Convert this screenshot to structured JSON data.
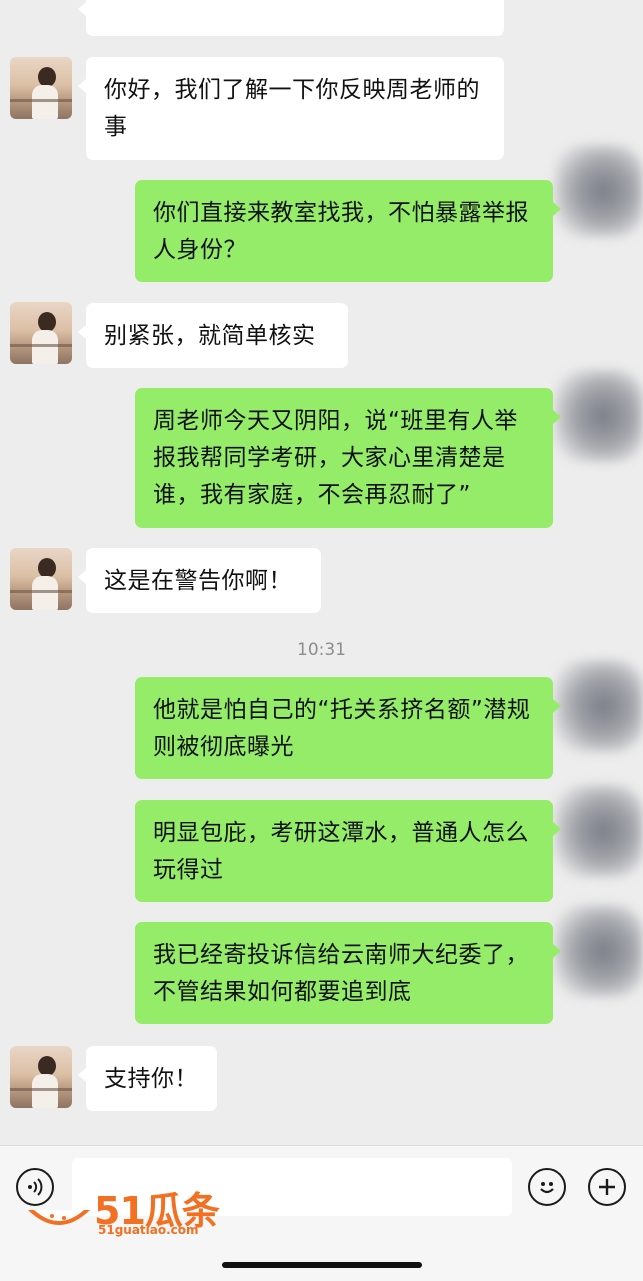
{
  "messages": [
    {
      "side": "left",
      "text": "你好，我们了解一下你反映周老师的事"
    },
    {
      "side": "right",
      "text": "你们直接来教室找我，不怕暴露举报人身份？"
    },
    {
      "side": "left",
      "text": "别紧张，就简单核实"
    },
    {
      "side": "right",
      "text": "周老师今天又阴阳，说“班里有人举报我帮同学考研，大家心里清楚是谁，我有家庭，不会再忍耐了”"
    },
    {
      "side": "left",
      "text": "这是在警告你啊！"
    },
    {
      "side": "right",
      "text": "他就是怕自己的“托关系挤名额”潜规则被彻底曝光"
    },
    {
      "side": "right",
      "text": "明显包庇，考研这潭水，普通人怎么玩得过"
    },
    {
      "side": "right",
      "text": "我已经寄投诉信给云南师大纪委了，不管结果如何都要追到底"
    },
    {
      "side": "left",
      "text": "支持你！"
    }
  ],
  "timestamp": "10:31",
  "bottom_bar": {
    "voice_icon": "voice-icon",
    "emoji_icon": "emoji-icon",
    "plus_icon": "plus-icon"
  },
  "watermark": {
    "brand": "51瓜条",
    "url": "51guatiao.com",
    "color": "#f36f21"
  },
  "colors": {
    "sent_bubble": "#95ec69",
    "received_bubble": "#ffffff",
    "background": "#ededed"
  }
}
